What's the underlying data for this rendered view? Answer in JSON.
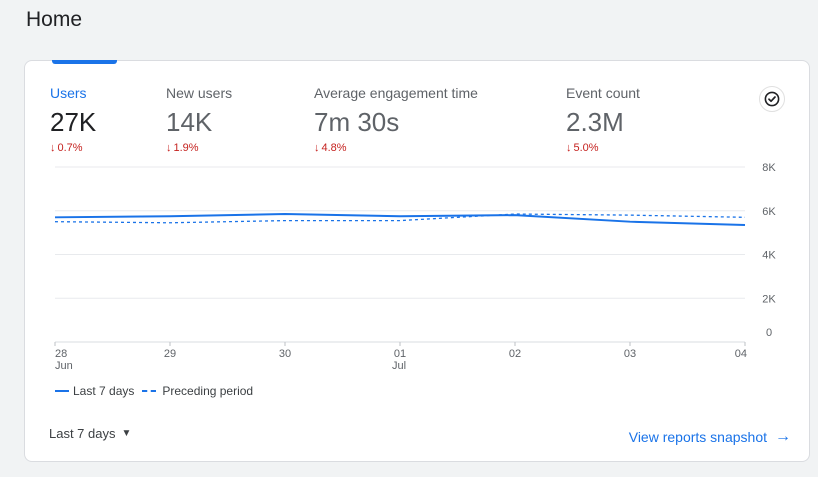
{
  "page": {
    "title": "Home"
  },
  "metrics": [
    {
      "label": "Users",
      "value": "27K",
      "change": "0.7%",
      "active": true
    },
    {
      "label": "New users",
      "value": "14K",
      "change": "1.9%",
      "active": false
    },
    {
      "label": "Average engagement time",
      "value": "7m 30s",
      "change": "4.8%",
      "active": false
    },
    {
      "label": "Event count",
      "value": "2.3M",
      "change": "5.0%",
      "active": false
    }
  ],
  "colors": {
    "accent": "#1a73e8",
    "negative": "#c5221f"
  },
  "icons": {
    "check": "check-circle-icon",
    "change": "arrow-down-icon",
    "link": "arrow-right-icon",
    "caret": "caret-down-icon"
  },
  "chart_data": {
    "type": "line",
    "categories": [
      "28 Jun",
      "29",
      "30",
      "01 Jul",
      "02",
      "03",
      "04"
    ],
    "x_tick_labels": [
      {
        "main": "28",
        "sub": "Jun"
      },
      {
        "main": "29",
        "sub": ""
      },
      {
        "main": "30",
        "sub": ""
      },
      {
        "main": "01",
        "sub": "Jul"
      },
      {
        "main": "02",
        "sub": ""
      },
      {
        "main": "03",
        "sub": ""
      },
      {
        "main": "04",
        "sub": ""
      }
    ],
    "y_tick_labels": [
      "8K",
      "6K",
      "4K",
      "2K",
      "0"
    ],
    "y_ticks": [
      8000,
      6000,
      4000,
      2000,
      0
    ],
    "ylim": [
      0,
      8000
    ],
    "grid": true,
    "legend_position": "bottom-left",
    "series": [
      {
        "name": "Last 7 days",
        "style": "solid",
        "values": [
          5700,
          5750,
          5850,
          5750,
          5800,
          5500,
          5350
        ]
      },
      {
        "name": "Preceding period",
        "style": "dashed",
        "values": [
          5500,
          5450,
          5550,
          5550,
          5850,
          5800,
          5700
        ]
      }
    ]
  },
  "footer": {
    "range_label": "Last 7 days",
    "snapshot_link": "View reports snapshot"
  }
}
